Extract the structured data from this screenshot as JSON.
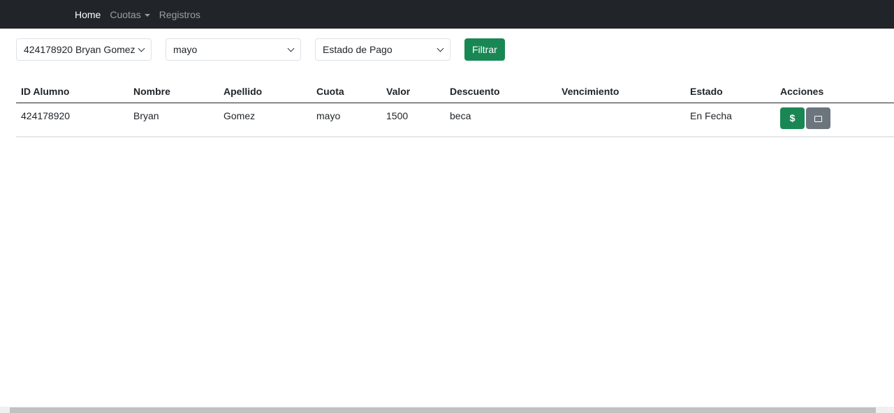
{
  "nav": {
    "home": "Home",
    "cuotas": "Cuotas",
    "registros": "Registros"
  },
  "filters": {
    "alumno": "424178920 Bryan Gomez",
    "mes": "mayo",
    "estado": "Estado de Pago",
    "filtrar": "Filtrar"
  },
  "table": {
    "headers": [
      "ID Alumno",
      "Nombre",
      "Apellido",
      "Cuota",
      "Valor",
      "Descuento",
      "Vencimiento",
      "Estado",
      "Acciones"
    ],
    "rows": [
      {
        "id": "424178920",
        "nombre": "Bryan",
        "apellido": "Gomez",
        "cuota": "mayo",
        "valor": "1500",
        "descuento": "beca",
        "vencimiento": "",
        "estado": "En Fecha",
        "pay_icon": "$"
      }
    ]
  },
  "colors": {
    "navbar": "#212529",
    "primary": "#198754",
    "secondary": "#6c757d"
  }
}
